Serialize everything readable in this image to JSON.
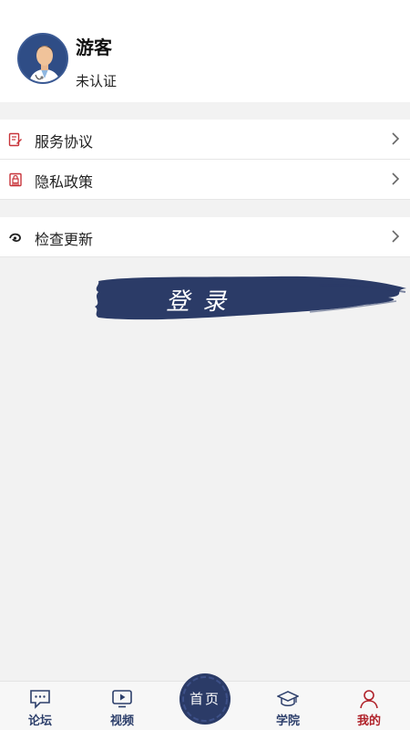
{
  "profile": {
    "name": "游客",
    "status": "未认证"
  },
  "menu": {
    "group1": [
      {
        "label": "服务协议",
        "icon": "document-pen-icon"
      },
      {
        "label": "隐私政策",
        "icon": "privacy-lock-icon"
      }
    ],
    "group2": [
      {
        "label": "检查更新",
        "icon": "update-icon"
      }
    ]
  },
  "login": {
    "label": "登录"
  },
  "tabbar": {
    "tabs": [
      {
        "label": "论坛",
        "icon": "chat-bubble-icon"
      },
      {
        "label": "视频",
        "icon": "video-play-icon"
      },
      {
        "label": "首页",
        "icon": "home-brush-icon"
      },
      {
        "label": "学院",
        "icon": "graduation-cap-icon"
      },
      {
        "label": "我的",
        "icon": "user-icon"
      }
    ],
    "active": "我的"
  },
  "colors": {
    "accent": "#2b3b67",
    "active_tab": "#b0222a",
    "icon_red": "#c8343a",
    "background": "#f2f2f2"
  }
}
